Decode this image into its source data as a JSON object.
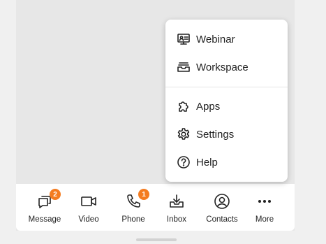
{
  "menu": {
    "items": [
      {
        "label": "Webinar",
        "icon": "webinar-icon"
      },
      {
        "label": "Workspace",
        "icon": "workspace-icon"
      },
      {
        "label": "Apps",
        "icon": "apps-icon"
      },
      {
        "label": "Settings",
        "icon": "settings-icon"
      },
      {
        "label": "Help",
        "icon": "help-icon"
      }
    ]
  },
  "bottom_bar": {
    "items": [
      {
        "label": "Message",
        "icon": "message-icon",
        "badge": "2"
      },
      {
        "label": "Video",
        "icon": "video-icon"
      },
      {
        "label": "Phone",
        "icon": "phone-icon",
        "badge": "1"
      },
      {
        "label": "Inbox",
        "icon": "inbox-icon"
      },
      {
        "label": "Contacts",
        "icon": "contacts-icon"
      },
      {
        "label": "More",
        "icon": "more-icon"
      }
    ]
  },
  "colors": {
    "badge": "#f47c20",
    "background": "#e7e7e7",
    "surface": "#ffffff"
  }
}
